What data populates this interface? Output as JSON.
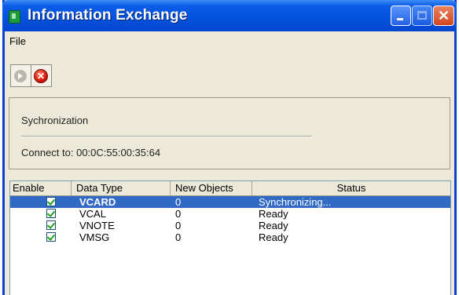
{
  "window": {
    "title": "Information Exchange",
    "close_glyph": "✕"
  },
  "menu": {
    "items": [
      {
        "label": "File"
      }
    ]
  },
  "toolbar": {
    "buttons": [
      {
        "icon": "sync-icon",
        "enabled": false
      },
      {
        "icon": "stop-icon",
        "enabled": true,
        "glyph": "✕"
      }
    ]
  },
  "sync_panel": {
    "title": "Sychronization",
    "connect_label": "Connect to: 00:0C:55:00:35:64"
  },
  "list": {
    "columns": [
      "Enable",
      "Data Type",
      "New Objects",
      "Status"
    ],
    "rows": [
      {
        "enabled": true,
        "type": "VCARD",
        "new_objects": "0",
        "status": "Synchronizing...",
        "selected": true
      },
      {
        "enabled": true,
        "type": "VCAL",
        "new_objects": "0",
        "status": "Ready",
        "selected": false
      },
      {
        "enabled": true,
        "type": "VNOTE",
        "new_objects": "0",
        "status": "Ready",
        "selected": false
      },
      {
        "enabled": true,
        "type": "VMSG",
        "new_objects": "0",
        "status": "Ready",
        "selected": false
      }
    ]
  },
  "colors": {
    "titlebar": "#0552dd",
    "selection": "#316ac5",
    "window_bg": "#ece9d8"
  }
}
